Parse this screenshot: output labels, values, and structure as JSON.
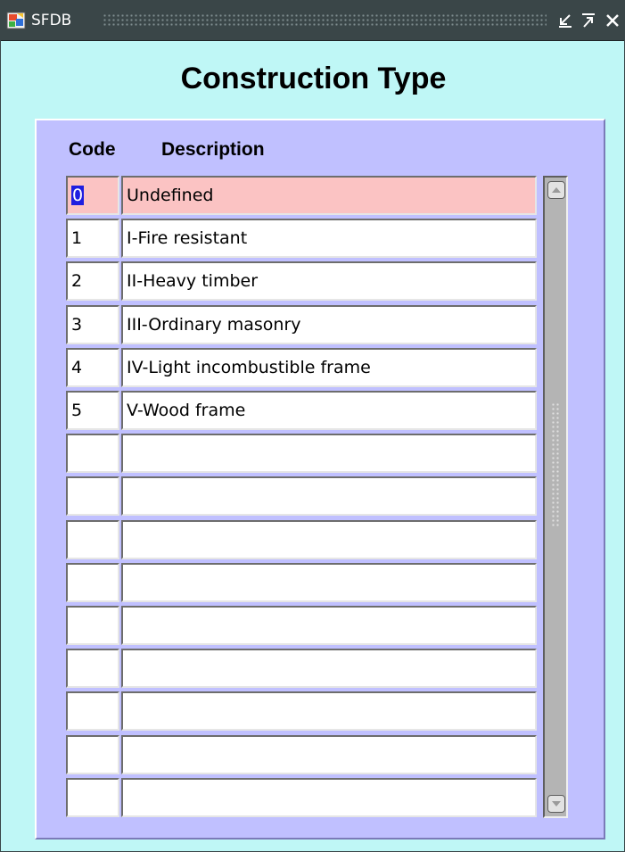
{
  "window": {
    "title": "SFDB"
  },
  "form": {
    "heading": "Construction Type",
    "columns": {
      "code": "Code",
      "description": "Description"
    },
    "selected_row_index": 0,
    "rows": [
      {
        "code": "0",
        "description": "Undefined"
      },
      {
        "code": "1",
        "description": "I-Fire resistant"
      },
      {
        "code": "2",
        "description": "II-Heavy timber"
      },
      {
        "code": "3",
        "description": "III-Ordinary masonry"
      },
      {
        "code": "4",
        "description": "IV-Light incombustible frame"
      },
      {
        "code": "5",
        "description": "V-Wood frame"
      },
      {
        "code": "",
        "description": ""
      },
      {
        "code": "",
        "description": ""
      },
      {
        "code": "",
        "description": ""
      },
      {
        "code": "",
        "description": ""
      },
      {
        "code": "",
        "description": ""
      },
      {
        "code": "",
        "description": ""
      },
      {
        "code": "",
        "description": ""
      },
      {
        "code": "",
        "description": ""
      },
      {
        "code": "",
        "description": ""
      }
    ]
  },
  "icons": {
    "app": "oracle-forms-app-icon",
    "minimize": "minimize-icon",
    "maximize": "maximize-icon",
    "close": "close-icon",
    "scroll_up": "scroll-up-arrow-icon",
    "scroll_down": "scroll-down-arrow-icon"
  },
  "colors": {
    "window_bg": "#bff7f6",
    "titlebar_bg": "#3a4648",
    "panel_bg": "#c0c0ff",
    "selected_row_bg": "#fbc3c3",
    "text_selection_bg": "#1e1ee0"
  }
}
